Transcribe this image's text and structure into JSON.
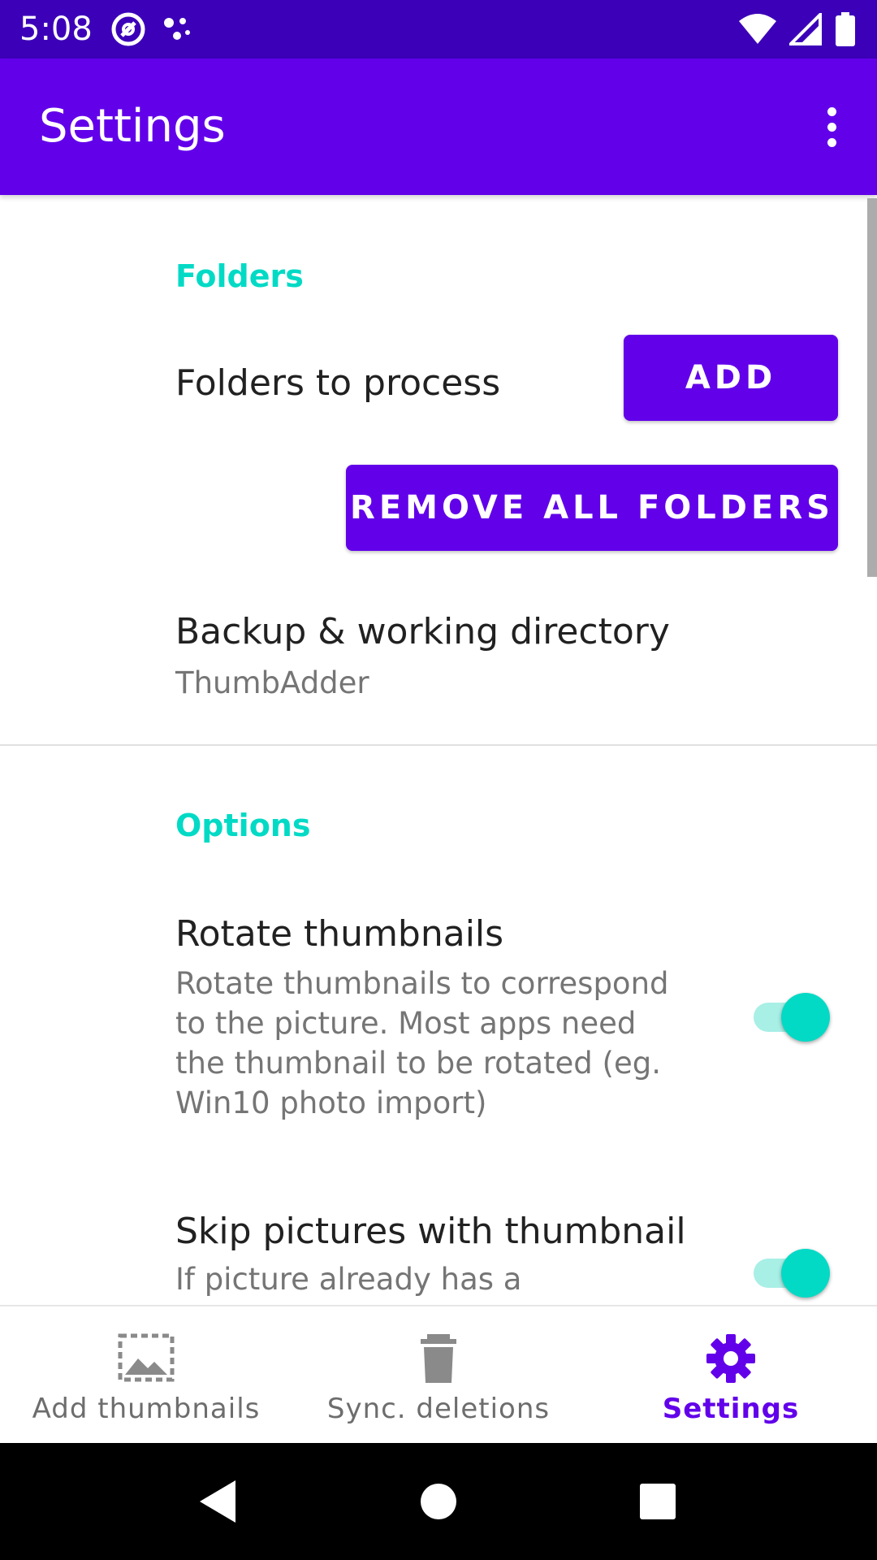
{
  "status_bar": {
    "time": "5:08",
    "left_icons": [
      "at-sign-icon",
      "dots-icon"
    ],
    "right_icons": [
      "wifi-icon",
      "cellular-icon",
      "battery-icon"
    ]
  },
  "app_bar": {
    "title": "Settings",
    "overflow_icon": "more-vert-icon",
    "color": "#6200ea"
  },
  "sections": {
    "folders": {
      "header": "Folders",
      "folders_to_process_label": "Folders to process",
      "add_button": "ADD",
      "remove_all_button": "REMOVE ALL FOLDERS",
      "backup_title": "Backup & working directory",
      "backup_value": "ThumbAdder"
    },
    "options": {
      "header": "Options",
      "rotate_title": "Rotate thumbnails",
      "rotate_summary": "Rotate thumbnails to correspond to the picture. Most apps need the thumbnail to be rotated (eg. Win10 photo import)",
      "rotate_enabled": true,
      "skip_title": "Skip pictures with thumbnail",
      "skip_summary": "If picture already has a",
      "skip_enabled": true
    }
  },
  "bottom_nav": {
    "items": [
      {
        "label": "Add thumbnails",
        "icon": "image-add-icon",
        "active": false
      },
      {
        "label": "Sync. deletions",
        "icon": "trash-icon",
        "active": false
      },
      {
        "label": "Settings",
        "icon": "gear-icon",
        "active": true
      }
    ]
  },
  "system_nav": {
    "buttons": [
      "back-icon",
      "home-icon",
      "recents-icon"
    ]
  },
  "colors": {
    "primary": "#6200ea",
    "primary_dark": "#3c00b8",
    "accent": "#03dac5",
    "switch_track": "#a8efe6"
  }
}
